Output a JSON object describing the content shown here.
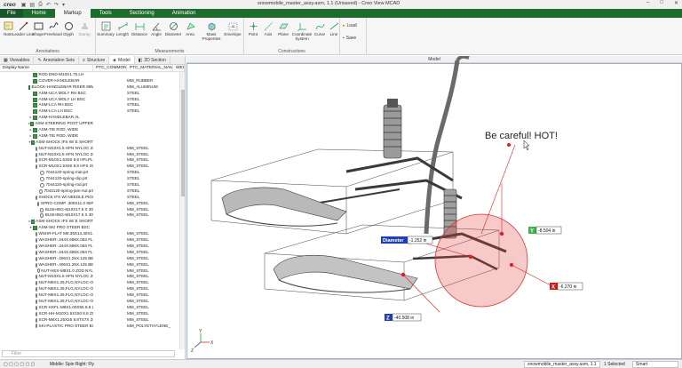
{
  "app": {
    "logo": "creo",
    "window_title": "snowmobile_master_assy.asm, 1.1 (Unsaved) - Creo View MCAD",
    "window_controls": [
      "–",
      "□",
      "✕"
    ]
  },
  "ribbon": {
    "tabs": [
      "File",
      "Home",
      "Markup",
      "Tools",
      "Sectioning",
      "Animation"
    ],
    "active_tab": "Markup",
    "groups": {
      "annotations": {
        "label": "Annotations",
        "buttons": [
          "Note",
          "Leader Line",
          "Shape",
          "Freehand",
          "Glyph",
          "Stamp"
        ]
      },
      "measurements": {
        "label": "Measurements",
        "buttons": [
          "Summary",
          "Length",
          "Distance",
          "Angle",
          "Diameter",
          "Area",
          "Mass Properties",
          "Envelope"
        ]
      },
      "constructions": {
        "label": "Constructions",
        "buttons": [
          "Point",
          "Axis",
          "Plane",
          "Coordinate System",
          "Curve",
          "Line"
        ]
      },
      "file_ops": [
        "Load",
        "Save"
      ]
    }
  },
  "left_panel": {
    "tabs": [
      "Viewables",
      "Annotation Sets",
      "Structure",
      "Model",
      "2D Section"
    ],
    "columns": [
      "Display Name",
      "PTC_COMMON_NAME",
      "PTC_MATERIAL_NAM...",
      "WEIGH"
    ],
    "rows": [
      {
        "name": "ROD END-M10X1.75 LH",
        "material": "",
        "icon": "check",
        "depth": 0,
        "exp": ""
      },
      {
        "name": "COVER-HANDLEBAR",
        "material": "MM_RUBBER",
        "icon": "check",
        "depth": 0,
        "exp": ""
      },
      {
        "name": "BLOCK-HANDLEBAR RISER 88MM",
        "material": "MM_ALUMINUM",
        "icon": "check",
        "depth": 0,
        "exp": ""
      },
      {
        "name": "ASM-UCA MOLY RH BSC",
        "material": "STEEL",
        "icon": "check",
        "depth": 0,
        "exp": ""
      },
      {
        "name": "ASM-UCA MOLY LH BSC",
        "material": "STEEL",
        "icon": "check",
        "depth": 0,
        "exp": ""
      },
      {
        "name": "ASM-LCA RH BSC",
        "material": "STEEL",
        "icon": "check",
        "depth": 0,
        "exp": ""
      },
      {
        "name": "ASM-LCA LH BSC",
        "material": "STEEL",
        "icon": "check",
        "depth": 0,
        "exp": ""
      },
      {
        "name": "ASM-HANDLEBAR AL",
        "material": "",
        "icon": "check",
        "depth": 0,
        "exp": "▸"
      },
      {
        "name": "ASM-STEERING POST UPPER",
        "material": "",
        "icon": "check",
        "depth": 0,
        "exp": "▸"
      },
      {
        "name": "ASM-TIE ROD, WIDE",
        "material": "",
        "icon": "check",
        "depth": 0,
        "exp": "▸"
      },
      {
        "name": "ASM-TIE ROD, WIDE",
        "material": "",
        "icon": "check",
        "depth": 0,
        "exp": "▸"
      },
      {
        "name": "ASM-SHOCK IFS W/ E SHORT",
        "material": "",
        "icon": "check",
        "depth": 0,
        "exp": "▾"
      },
      {
        "name": "NUT-M10X1.5 HFN NYLOC ZOD",
        "material": "MM_STEEL",
        "icon": "gear",
        "depth": 1,
        "exp": ""
      },
      {
        "name": "NUT-M10X1.5 HFN NYLOC ZOD",
        "material": "MM_STEEL",
        "icon": "gear",
        "depth": 1,
        "exp": ""
      },
      {
        "name": "SCR-M10X1.5X50 8.8 HFLPL ZOD",
        "material": "MM_STEEL",
        "icon": "gear",
        "depth": 1,
        "exp": ""
      },
      {
        "name": "SCR-M10X1.5X60 8.8 HFS ZOD",
        "material": "MM_STEEL",
        "icon": "gear",
        "depth": 1,
        "exp": ""
      },
      {
        "name": "7044120-spring-mat.prt",
        "material": "STEEL",
        "icon": "gear",
        "depth": 1,
        "exp": ""
      },
      {
        "name": "7044120-spring-clip.prt",
        "material": "STEEL",
        "icon": "gear",
        "depth": 1,
        "exp": ""
      },
      {
        "name": "7044120-spring-rod.prt",
        "material": "STEEL",
        "icon": "gear",
        "depth": 1,
        "exp": ""
      },
      {
        "name": "7044120-spring-jam-nut.prt",
        "material": "STEEL",
        "icon": "gear",
        "depth": 1,
        "exp": ""
      },
      {
        "name": "SHOCK IFS W/ NEEDLE PIGGY SHRT",
        "material": "STEEL",
        "icon": "gear",
        "depth": 1,
        "exp": ""
      },
      {
        "name": "SPRG-COMP .306X11.0 80#",
        "material": "MM_STEEL",
        "icon": "gear",
        "depth": 1,
        "exp": ""
      },
      {
        "name": "BUSHING-M10X17.5 X 30",
        "material": "MM_STEEL",
        "icon": "gear",
        "depth": 1,
        "exp": ""
      },
      {
        "name": "BUSHING-M10X17.5 X 30",
        "material": "MM_STEEL",
        "icon": "gear",
        "depth": 1,
        "exp": ""
      },
      {
        "name": "ASM-SHOCK IFS W/ E SHORT",
        "material": "",
        "icon": "check",
        "depth": 0,
        "exp": "▸"
      },
      {
        "name": "ASM-SKI PRO STEER BSC",
        "material": "",
        "icon": "check",
        "depth": 0,
        "exp": "▾"
      },
      {
        "name": "WSHR-FLAT M8.35X14.30X1.2 ZOD",
        "material": "MM_STEEL",
        "icon": "gear",
        "depth": 1,
        "exp": ""
      },
      {
        "name": "WASHER-.344X.688X.063 FL-ZOD",
        "material": "MM_STEEL",
        "icon": "gear",
        "depth": 1,
        "exp": ""
      },
      {
        "name": "WASHER-.344X.688X.063 FL-ZOD",
        "material": "MM_STEEL",
        "icon": "gear",
        "depth": 1,
        "exp": ""
      },
      {
        "name": "WASHER-.344X.688X.063 FL-ZOD",
        "material": "MM_STEEL",
        "icon": "gear",
        "depth": 1,
        "exp": ""
      },
      {
        "name": "WASHER-.406X1.25X.125 BELLS-Y",
        "material": "MM_STEEL",
        "icon": "gear",
        "depth": 1,
        "exp": ""
      },
      {
        "name": "WASHER-.406X1.25X.125 BELLS-Y",
        "material": "MM_STEEL",
        "icon": "gear",
        "depth": 1,
        "exp": ""
      },
      {
        "name": "NUT-HEX-M8X1.0 ZOD NYL",
        "material": "MM_STEEL",
        "icon": "gear",
        "depth": 1,
        "exp": ""
      },
      {
        "name": "NUT-M10X1.5 HFN NYLOC ZOD",
        "material": "MM_STEEL",
        "icon": "gear",
        "depth": 1,
        "exp": ""
      },
      {
        "name": "NUT-M8X1.25,FLG,NYLOC-OLIVE D",
        "material": "MM_STEEL",
        "icon": "gear",
        "depth": 1,
        "exp": ""
      },
      {
        "name": "NUT-M8X1.25,FLG,NYLOC-OLIVE D",
        "material": "MM_STEEL",
        "icon": "gear",
        "depth": 1,
        "exp": ""
      },
      {
        "name": "NUT-M8X1.25,FLG,NYLOC-OLIVE D",
        "material": "MM_STEEL",
        "icon": "gear",
        "depth": 1,
        "exp": ""
      },
      {
        "name": "NUT-M8X1.25,FLG,NYLOC-OLIVE D",
        "material": "MM_STEEL",
        "icon": "gear",
        "depth": 1,
        "exp": ""
      },
      {
        "name": "SCR-HXFL-M8X1.00X55 8.8 ZOD",
        "material": "MM_STEEL",
        "icon": "gear",
        "depth": 1,
        "exp": ""
      },
      {
        "name": "SCR-HH-M10X1.5X150 8.8 ZOD",
        "material": "MM_STEEL",
        "icon": "gear",
        "depth": 1,
        "exp": ""
      },
      {
        "name": "SCR-M8X1.25X25 8.8TS7X ZOD P80",
        "material": "MM_STEEL",
        "icon": "gear",
        "depth": 1,
        "exp": ""
      },
      {
        "name": "SKI-PLASTIC PRO STEER BSC",
        "material": "MM_POLYETHYLENE_",
        "icon": "gear",
        "depth": 1,
        "exp": ""
      }
    ],
    "filter_placeholder": "Filter"
  },
  "graphics": {
    "title": "Model",
    "note_text": "Be careful! HOT!",
    "dimensions": [
      {
        "axis": "Y",
        "value": "-8.504 in",
        "color": "#3ab54a"
      },
      {
        "axis": "Diameter",
        "value": "-1.252 in",
        "color": "#1f3fb0"
      },
      {
        "axis": "X",
        "value": "-6.270 in",
        "color": "#d11a1a"
      },
      {
        "axis": "Z",
        "value": "-40.508 in",
        "color": "#1f3fb0"
      }
    ],
    "triad_labels": [
      "X",
      "Y",
      "Z"
    ]
  },
  "status_bar": {
    "mouse_hint": "Middle: Spin  Right: Fly",
    "part_select": "snowmobile_master_assy.asm, 1.1",
    "selected": "1 Selected",
    "mode": "Smart"
  }
}
